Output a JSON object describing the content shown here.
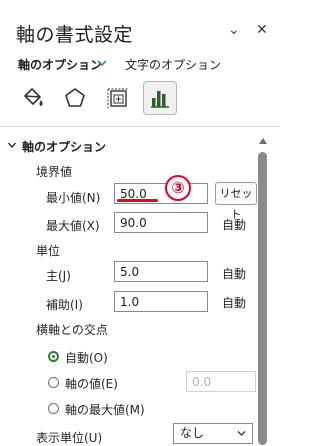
{
  "pane": {
    "title": "軸の書式設定",
    "controls": {
      "options_glyph": "⌄",
      "close_glyph": "✕"
    }
  },
  "tabs": {
    "axis_options": "軸のオプション",
    "text_options": "文字のオプション"
  },
  "category_icons": [
    {
      "name": "fill-line-icon",
      "selected": false
    },
    {
      "name": "effects-icon",
      "selected": false
    },
    {
      "name": "size-properties-icon",
      "selected": false
    },
    {
      "name": "axis-options-icon",
      "selected": true
    }
  ],
  "section": {
    "title": "軸のオプション",
    "bounds": {
      "label": "境界値",
      "min": {
        "label": "最小値(N)",
        "value": "50.0",
        "button": "リセット"
      },
      "max": {
        "label": "最大値(X)",
        "value": "90.0",
        "state": "自動"
      }
    },
    "units": {
      "label": "単位",
      "major": {
        "label": "主(J)",
        "value": "5.0",
        "state": "自動"
      },
      "minor": {
        "label": "補助(I)",
        "value": "1.0",
        "state": "自動"
      }
    },
    "crosses": {
      "label": "横軸との交点",
      "options": [
        {
          "label": "自動(O)",
          "checked": true
        },
        {
          "label": "軸の値(E)",
          "checked": false,
          "value": "0.0"
        },
        {
          "label": "軸の最大値(M)",
          "checked": false
        }
      ]
    },
    "display_units": {
      "label": "表示単位(U)",
      "value": "なし"
    }
  },
  "annotation": {
    "number": "③",
    "color": "#e60026"
  },
  "colors": {
    "accent_green": "#2e7d32",
    "annotation_red": "#e60026"
  }
}
